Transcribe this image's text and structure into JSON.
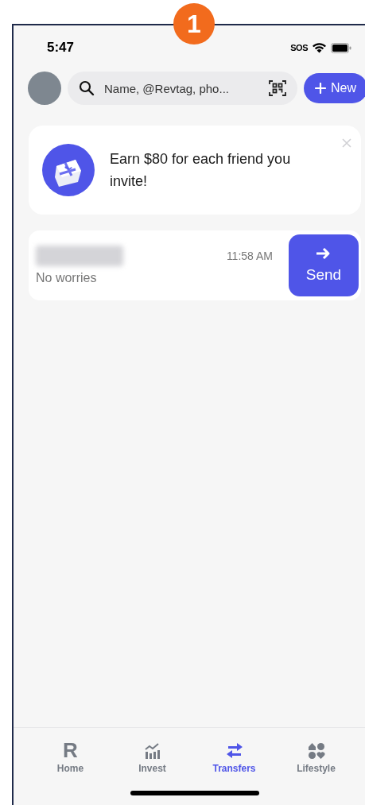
{
  "step_badge": "1",
  "status_bar": {
    "time": "5:47",
    "carrier": "SOS"
  },
  "search": {
    "placeholder": "Name, @Revtag, pho..."
  },
  "new_button": {
    "label": "New"
  },
  "promo": {
    "text": "Earn $80 for each friend you invite!"
  },
  "conversations": [
    {
      "message": "No worries",
      "time": "11:58 AM",
      "action": "Send"
    }
  ],
  "tabs": [
    {
      "kind": "home",
      "logo": "R",
      "label": "Home",
      "selected": false
    },
    {
      "kind": "invest",
      "label": "Invest",
      "selected": false
    },
    {
      "kind": "transfers",
      "label": "Transfers",
      "selected": true
    },
    {
      "kind": "lifestyle",
      "label": "Lifestyle",
      "selected": false
    }
  ]
}
